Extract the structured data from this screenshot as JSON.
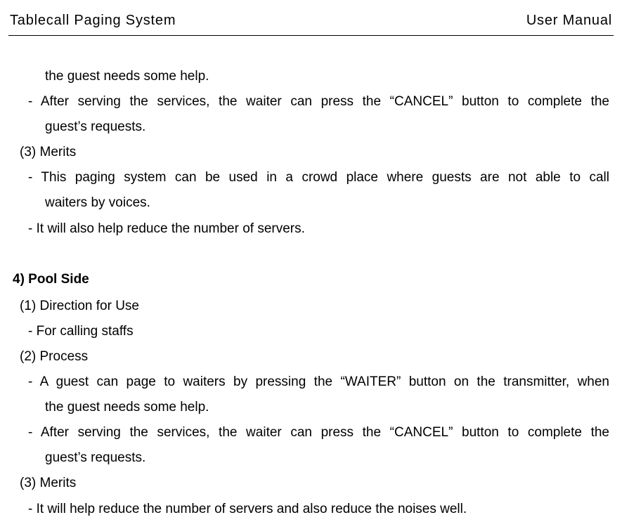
{
  "header": {
    "left": "Tablecall Paging System",
    "right": "User Manual"
  },
  "body": {
    "l1": "the guest needs some help.",
    "l2a": "- After serving the services, the waiter can press the “CANCEL” button to complete the",
    "l2b": "guest’s requests.",
    "s3_title": "(3) Merits",
    "l3a": "- This paging system can be used in a crowd place where guests are not able to call",
    "l3b": "waiters by voices.",
    "l4": "- It will also help reduce the number of servers.",
    "sec4_title": "4) Pool Side",
    "sec4_1_title": "(1) Direction for Use",
    "sec4_1_l1": "- For calling staffs",
    "sec4_2_title": "(2) Process",
    "sec4_2_l1a": "- A guest can page to waiters by pressing the “WAITER” button on the transmitter, when",
    "sec4_2_l1b": "the guest needs some help.",
    "sec4_2_l2a": "- After serving the services, the waiter can press the “CANCEL” button to complete the",
    "sec4_2_l2b": "guest’s requests.",
    "sec4_3_title": "(3) Merits",
    "sec4_3_l1": "- It will help reduce the number of servers and also reduce the noises well."
  }
}
